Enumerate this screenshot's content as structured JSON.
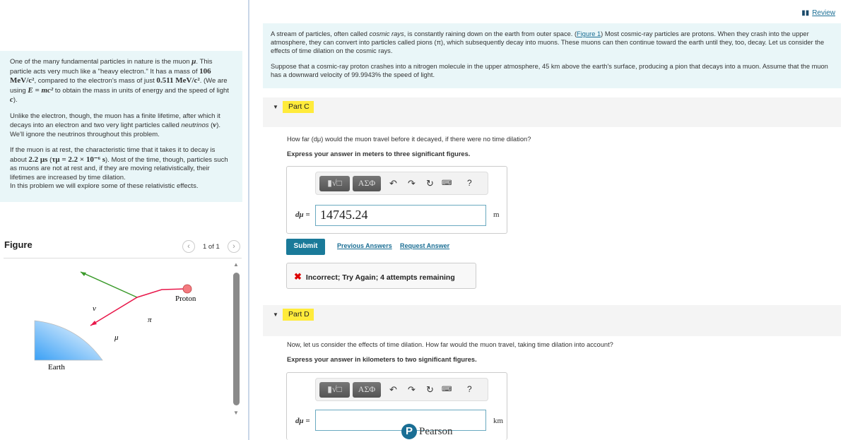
{
  "left_intro": {
    "p1_a": "One of the many fundamental particles in nature is the muon ",
    "p1_mu": "μ",
    "p1_b": ". This particle acts very much like a \"heavy electron.\" It has a mass of ",
    "p1_mass": "106 MeV/c²",
    "p1_c": ", compared to the electron's mass of just ",
    "p1_emass": "0.511 MeV/c²",
    "p1_d": ". (We are using ",
    "p1_eq": "E = mc²",
    "p1_e": " to obtain the mass in units of energy and the speed of light ",
    "p1_c_sym": "c",
    "p1_f": ").",
    "p2_a": "Unlike the electron, though, the muon has a finite lifetime, after which it decays into an electron and two very light particles called ",
    "p2_neutrinos": "neutrinos",
    "p2_b": " (",
    "p2_nu": "ν",
    "p2_c": "). We'll ignore the neutrinos throughout this problem.",
    "p3_a": "If the muon is at rest, the characteristic time that it takes it to decay is about ",
    "p3_time": "2.2 μs",
    "p3_b": " (",
    "p3_tau": "τμ = 2.2 × 10⁻⁶ s",
    "p3_c": "). Most of the time, though, particles such as muons are not at rest and, if they are moving relativistically, their lifetimes are increased by time dilation.",
    "p3_d": "In this problem we will explore some of these relativistic effects."
  },
  "figure": {
    "title": "Figure",
    "pager": "1 of 1",
    "labels": {
      "nu": "ν",
      "pi": "π",
      "mu": "μ",
      "proton": "Proton",
      "earth": "Earth"
    }
  },
  "header": {
    "review_label": "Review"
  },
  "right_intro": {
    "p1_a": "A stream of particles, often called ",
    "p1_em": "cosmic rays",
    "p1_b": ", is constantly raining down on the earth from outer space. (",
    "p1_link": "Figure 1",
    "p1_c": ") Most cosmic-ray particles are protons. When they crash into the upper atmosphere, they can convert into particles called pions (π), which subsequently decay into muons. These muons can then continue toward the earth until they, too, decay. Let us consider the effects of time dilation on the cosmic rays.",
    "p2": "Suppose that a cosmic-ray proton crashes into a nitrogen molecule in the upper atmosphere, 45 km above the earth's surface, producing a pion that decays into a muon. Assume that the muon has a downward velocity of 99.9943% the speed of light."
  },
  "part_c": {
    "label": "Part C",
    "question": "How far (dμ) would the muon travel before it decayed, if there were no time dilation?",
    "instruction": "Express your answer in meters to three significant figures.",
    "toolbar": {
      "templates": "▮√□",
      "greek": "ΑΣΦ",
      "help": "?"
    },
    "variable": "dμ =",
    "value": "14745.24",
    "unit": "m",
    "submit": "Submit",
    "previous_answers": "Previous Answers",
    "request_answer": "Request Answer",
    "feedback": "Incorrect; Try Again; 4 attempts remaining"
  },
  "part_d": {
    "label": "Part D",
    "question": "Now, let us consider the effects of time dilation. How far would the muon travel, taking time dilation into account?",
    "instruction": "Express your answer in kilometers to two significant figures.",
    "toolbar": {
      "templates": "▮√□",
      "greek": "ΑΣΦ",
      "help": "?"
    },
    "variable": "dμ =",
    "value": "",
    "unit": "km"
  },
  "footer": {
    "brand": "Pearson",
    "brand_logo": "P"
  },
  "colors": {
    "accent": "#1a7a99",
    "highlight": "#ffeb3b",
    "panel": "#e9f6f8",
    "error": "#dd0000"
  }
}
